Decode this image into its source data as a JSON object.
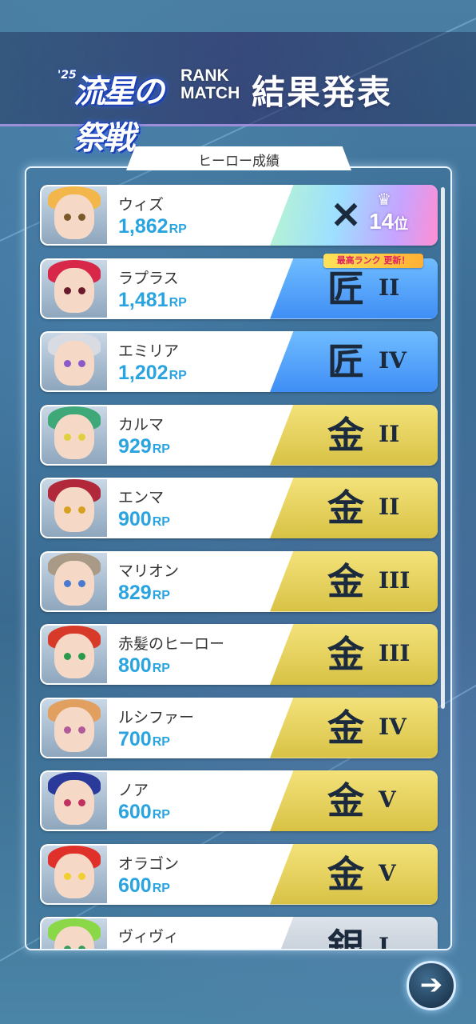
{
  "header": {
    "logo_year": "'25",
    "logo_title": "流星の祭戦",
    "rank_line1": "RANK",
    "rank_line2": "MATCH",
    "result_title": "結果発表"
  },
  "panel": {
    "tab_label": "ヒーロー成績",
    "best_rank_tag": "最高ランク 更新！"
  },
  "heroes": [
    {
      "name": "ウィズ",
      "rp": "1,862",
      "unit": "RP",
      "rank_style": "rainbow",
      "emblem": "✕",
      "tier": "",
      "place": "14",
      "place_suffix": "位",
      "hair": "#f2b64a",
      "eye": "#7a5a2a"
    },
    {
      "name": "ラプラス",
      "rp": "1,481",
      "unit": "RP",
      "rank_style": "blue",
      "emblem": "匠",
      "tier": "II",
      "hair": "#d8284a",
      "eye": "#6a1a2a"
    },
    {
      "name": "エミリア",
      "rp": "1,202",
      "unit": "RP",
      "rank_style": "blue",
      "emblem": "匠",
      "tier": "IV",
      "hair": "#d9dbe2",
      "eye": "#8a5ac6"
    },
    {
      "name": "カルマ",
      "rp": "929",
      "unit": "RP",
      "rank_style": "gold",
      "emblem": "金",
      "tier": "II",
      "hair": "#3fa878",
      "eye": "#e0d040"
    },
    {
      "name": "エンマ",
      "rp": "900",
      "unit": "RP",
      "rank_style": "gold",
      "emblem": "金",
      "tier": "II",
      "hair": "#b0283a",
      "eye": "#d8a020"
    },
    {
      "name": "マリオン",
      "rp": "829",
      "unit": "RP",
      "rank_style": "gold",
      "emblem": "金",
      "tier": "III",
      "hair": "#a89a86",
      "eye": "#4a7ad0"
    },
    {
      "name": "赤髪のヒーロー",
      "rp": "800",
      "unit": "RP",
      "rank_style": "gold",
      "emblem": "金",
      "tier": "III",
      "hair": "#d83a2a",
      "eye": "#2a9a4a"
    },
    {
      "name": "ルシファー",
      "rp": "700",
      "unit": "RP",
      "rank_style": "gold",
      "emblem": "金",
      "tier": "IV",
      "hair": "#e2a060",
      "eye": "#b05a9a"
    },
    {
      "name": "ノア",
      "rp": "600",
      "unit": "RP",
      "rank_style": "gold",
      "emblem": "金",
      "tier": "V",
      "hair": "#2a3a9a",
      "eye": "#c03060"
    },
    {
      "name": "オラゴン",
      "rp": "600",
      "unit": "RP",
      "rank_style": "gold",
      "emblem": "金",
      "tier": "V",
      "hair": "#e0302a",
      "eye": "#f0d030"
    },
    {
      "name": "ヴィヴィ",
      "rp": "",
      "unit": "",
      "rank_style": "silver",
      "emblem": "銀",
      "tier": "I",
      "hair": "#8ad848",
      "eye": "#3a9a5a"
    }
  ],
  "next_button_icon": "arrow-right-icon"
}
